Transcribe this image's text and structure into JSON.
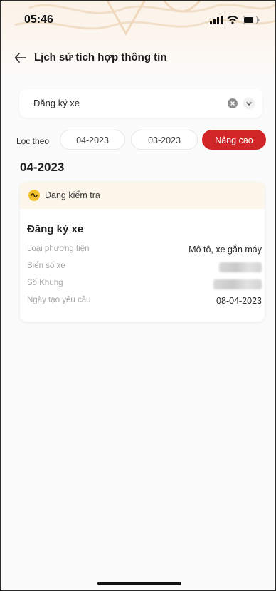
{
  "status_bar": {
    "time": "05:46"
  },
  "nav": {
    "title": "Lịch sử tích hợp thông tin"
  },
  "filter_select": {
    "value": "Đăng ký xe"
  },
  "filter": {
    "label": "Lọc theo",
    "chips": [
      "04-2023",
      "03-2023",
      "Nâng cao"
    ]
  },
  "group": {
    "month": "04-2023",
    "card": {
      "status": "Đang kiểm tra",
      "title": "Đăng ký xe",
      "rows": [
        {
          "label": "Loại phương tiện",
          "value": "Mô tô, xe gắn máy"
        },
        {
          "label": "Biển số xe",
          "value": ""
        },
        {
          "label": "Số Khung",
          "value": ""
        },
        {
          "label": "Ngày tạo yêu cầu",
          "value": "08-04-2023"
        }
      ]
    }
  },
  "colors": {
    "accent": "#d12628",
    "status_bg": "#fdf6ea",
    "status_icon": "#f2c12e"
  }
}
